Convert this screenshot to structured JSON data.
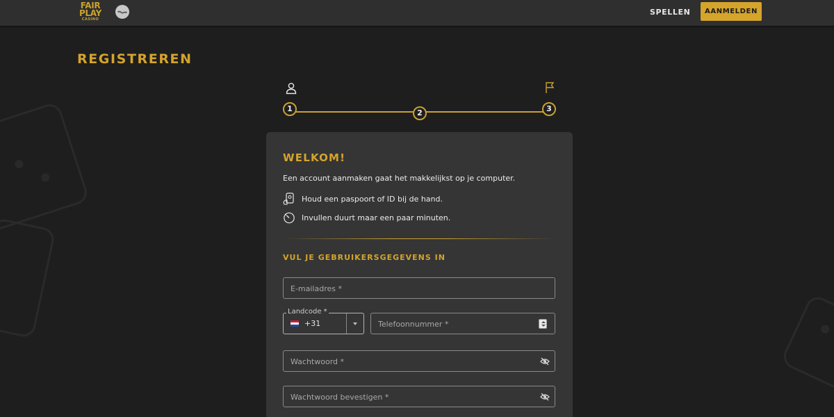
{
  "header": {
    "logo": {
      "line1": "FAIR",
      "line2": "PLAY",
      "line3": "CASINO"
    },
    "nav_games": "SPELLEN",
    "login_label": "AANMELDEN"
  },
  "page": {
    "title": "REGISTREREN"
  },
  "stepper": {
    "steps": [
      {
        "label": "1"
      },
      {
        "label": "2"
      },
      {
        "label": "3"
      }
    ],
    "icons": {
      "start": "user-icon",
      "end": "flag-icon"
    }
  },
  "card": {
    "title": "WELKOM!",
    "intro": "Een account aanmaken gaat het makkelijkst op je computer.",
    "tips": [
      {
        "icon": "id-card-icon",
        "text": "Houd een paspoort of ID bij de hand."
      },
      {
        "icon": "stopwatch-icon",
        "text": "Invullen duurt maar een paar minuten."
      }
    ],
    "section_title": "VUL JE GEBRUIKERSGEGEVENS IN"
  },
  "form": {
    "email": {
      "placeholder": "E-mailadres *",
      "value": ""
    },
    "country_code": {
      "label": "Landcode *",
      "value": "+31",
      "flag": "netherlands-flag-icon"
    },
    "phone": {
      "placeholder": "Telefoonnummer *",
      "value": ""
    },
    "password": {
      "placeholder": "Wachtwoord *",
      "value": ""
    },
    "password_confirm": {
      "placeholder": "Wachtwoord bevestigen *",
      "value": ""
    }
  },
  "colors": {
    "accent": "#d5a42b",
    "background": "#1e1e1e",
    "topbar": "#2f2f2f",
    "card": "#353535"
  }
}
